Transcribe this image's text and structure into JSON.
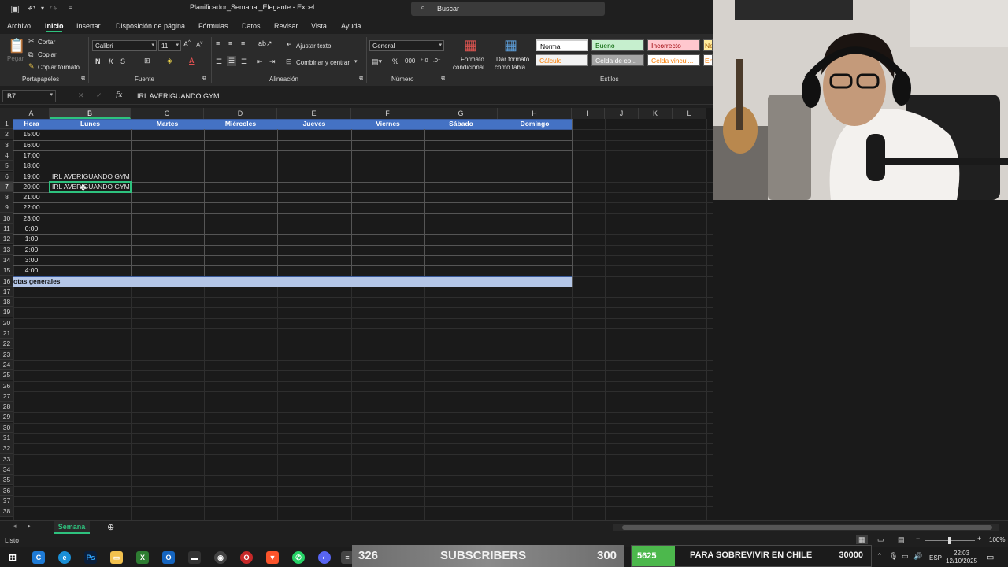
{
  "titlebar": {
    "doc_title": "Planificador_Semanal_Elegante - Excel",
    "search_label": "Buscar"
  },
  "menu": {
    "tabs": [
      "Archivo",
      "Inicio",
      "Insertar",
      "Disposición de página",
      "Fórmulas",
      "Datos",
      "Revisar",
      "Vista",
      "Ayuda"
    ],
    "active": "Inicio"
  },
  "ribbon": {
    "clipboard": {
      "paste": "Pegar",
      "cut": "Cortar",
      "copy": "Copiar",
      "format_painter": "Copiar formato",
      "group": "Portapapeles"
    },
    "font": {
      "name": "Calibri",
      "size": "11",
      "group": "Fuente"
    },
    "alignment": {
      "wrap": "Ajustar texto",
      "merge": "Combinar y centrar",
      "group": "Alineación"
    },
    "number": {
      "format": "General",
      "group": "Número"
    },
    "styles": {
      "cond_format_1": "Formato",
      "cond_format_2": "condicional",
      "table_format_1": "Dar formato",
      "table_format_2": "como tabla",
      "group": "Estilos",
      "cells": [
        "Normal",
        "Bueno",
        "Incorrecto",
        "Ne",
        "Cálculo",
        "Celda de co...",
        "Celda vincul...",
        "En"
      ]
    }
  },
  "formula_bar": {
    "name_box": "B7",
    "content": "IRL AVERIGUANDO GYM"
  },
  "grid": {
    "columns": [
      "A",
      "B",
      "C",
      "D",
      "E",
      "F",
      "G",
      "H",
      "I",
      "J",
      "K",
      "L"
    ],
    "headers": [
      "Hora",
      "Lunes",
      "Martes",
      "Miércoles",
      "Jueves",
      "Viernes",
      "Sábado",
      "Domingo"
    ],
    "hours": [
      "15:00",
      "16:00",
      "17:00",
      "18:00",
      "19:00",
      "20:00",
      "21:00",
      "22:00",
      "23:00",
      "0:00",
      "1:00",
      "2:00",
      "3:00",
      "4:00"
    ],
    "entries": [
      {
        "row": "6",
        "col": "B",
        "text": "IRL AVERIGUANDO GYM"
      },
      {
        "row": "7",
        "col": "B",
        "text": "IRL AVERIGUANDO GYM"
      }
    ],
    "notes_label": "otas generales",
    "row_count": 38,
    "selected": "B7",
    "header_color": "#4472c4",
    "notes_color": "#b4c6e7"
  },
  "sheets": {
    "active": "Semana"
  },
  "status": {
    "text": "Listo",
    "zoom": "100%"
  },
  "overlay": {
    "subs_current": "326",
    "subs_label": "SUBSCRIBERS",
    "subs_goal": "300",
    "goal_current": "5625",
    "goal_label": "PARA SOBREVIVIR EN CHILE",
    "goal_target": "30000"
  },
  "tray": {
    "lang": "ESP",
    "time": "22:03",
    "date": "12/10/2025"
  }
}
